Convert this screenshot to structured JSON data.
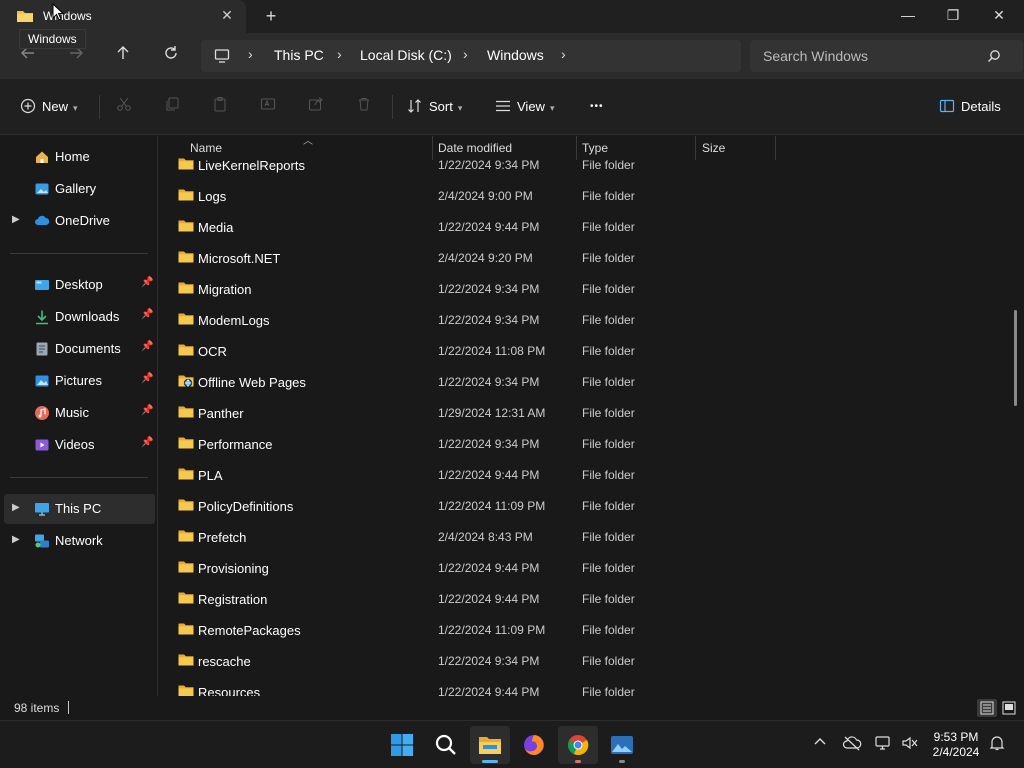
{
  "window": {
    "tab_title": "Windows",
    "tooltip": "Windows",
    "new_tab": "+",
    "minimize": "—",
    "maximize": "❐",
    "close": "✕"
  },
  "address": {
    "crumbs": [
      "This PC",
      "Local Disk (C:)",
      "Windows"
    ],
    "separator": "›",
    "search_placeholder": "Search Windows"
  },
  "commands": {
    "new": "New",
    "sort": "Sort",
    "view": "View",
    "more": "•••",
    "details": "Details"
  },
  "sidebar": {
    "items": [
      {
        "label": "Home",
        "icon": "home-icon",
        "expandable": false
      },
      {
        "label": "Gallery",
        "icon": "gallery-icon",
        "expandable": false
      },
      {
        "label": "OneDrive",
        "icon": "cloud-icon",
        "expandable": true
      },
      {
        "label": "Desktop",
        "icon": "desktop-icon",
        "pinned": true
      },
      {
        "label": "Downloads",
        "icon": "download-icon",
        "pinned": true
      },
      {
        "label": "Documents",
        "icon": "document-icon",
        "pinned": true
      },
      {
        "label": "Pictures",
        "icon": "picture-icon",
        "pinned": true
      },
      {
        "label": "Music",
        "icon": "music-icon",
        "pinned": true
      },
      {
        "label": "Videos",
        "icon": "video-icon",
        "pinned": true
      },
      {
        "label": "This PC",
        "icon": "pc-icon",
        "expandable": true,
        "selected": true
      },
      {
        "label": "Network",
        "icon": "network-icon",
        "expandable": true
      }
    ]
  },
  "columns": {
    "name": "Name",
    "date": "Date modified",
    "type": "Type",
    "size": "Size"
  },
  "files": [
    {
      "name": "LiveKernelReports",
      "date": "1/22/2024 9:34 PM",
      "type": "File folder"
    },
    {
      "name": "Logs",
      "date": "2/4/2024 9:00 PM",
      "type": "File folder"
    },
    {
      "name": "Media",
      "date": "1/22/2024 9:44 PM",
      "type": "File folder"
    },
    {
      "name": "Microsoft.NET",
      "date": "2/4/2024 9:20 PM",
      "type": "File folder"
    },
    {
      "name": "Migration",
      "date": "1/22/2024 9:34 PM",
      "type": "File folder"
    },
    {
      "name": "ModemLogs",
      "date": "1/22/2024 9:34 PM",
      "type": "File folder"
    },
    {
      "name": "OCR",
      "date": "1/22/2024 11:08 PM",
      "type": "File folder"
    },
    {
      "name": "Offline Web Pages",
      "date": "1/22/2024 9:34 PM",
      "type": "File folder",
      "special": true
    },
    {
      "name": "Panther",
      "date": "1/29/2024 12:31 AM",
      "type": "File folder"
    },
    {
      "name": "Performance",
      "date": "1/22/2024 9:34 PM",
      "type": "File folder"
    },
    {
      "name": "PLA",
      "date": "1/22/2024 9:44 PM",
      "type": "File folder"
    },
    {
      "name": "PolicyDefinitions",
      "date": "1/22/2024 11:09 PM",
      "type": "File folder"
    },
    {
      "name": "Prefetch",
      "date": "2/4/2024 8:43 PM",
      "type": "File folder"
    },
    {
      "name": "Provisioning",
      "date": "1/22/2024 9:44 PM",
      "type": "File folder"
    },
    {
      "name": "Registration",
      "date": "1/22/2024 9:44 PM",
      "type": "File folder"
    },
    {
      "name": "RemotePackages",
      "date": "1/22/2024 11:09 PM",
      "type": "File folder"
    },
    {
      "name": "rescache",
      "date": "1/22/2024 9:34 PM",
      "type": "File folder"
    },
    {
      "name": "Resources",
      "date": "1/22/2024 9:44 PM",
      "type": "File folder"
    }
  ],
  "status": {
    "item_count": "98 items"
  },
  "clock": {
    "time": "9:53 PM",
    "date": "2/4/2024"
  },
  "colors": {
    "folder": "#f2c044",
    "accent": "#5fb2f2"
  }
}
